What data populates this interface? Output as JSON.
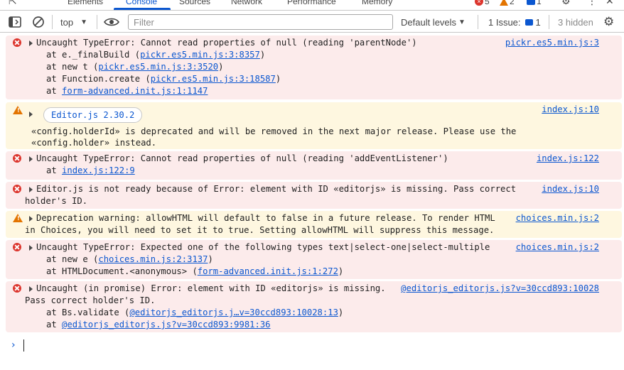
{
  "tabs": {
    "elements": "Elements",
    "console": "Console",
    "sources": "Sources",
    "network": "Network",
    "performance": "Performance",
    "memory": "Memory"
  },
  "counters": {
    "errors": "5",
    "warnings": "2",
    "messages": "1"
  },
  "toolbar": {
    "context": "top",
    "filter_placeholder": "Filter",
    "levels": "Default levels",
    "issues": "1 Issue:",
    "issues_count": "1",
    "hidden": "3 hidden"
  },
  "messages": [
    {
      "type": "error",
      "text": "Uncaught TypeError: Cannot read properties of null (reading 'parentNode')",
      "source": "pickr.es5.min.js:3",
      "stack": [
        {
          "prefix": "at e._finalBuild (",
          "link": "pickr.es5.min.js:3:8357",
          "suffix": ")"
        },
        {
          "prefix": "at new t (",
          "link": "pickr.es5.min.js:3:3520",
          "suffix": ")"
        },
        {
          "prefix": "at Function.create (",
          "link": "pickr.es5.min.js:3:18587",
          "suffix": ")"
        },
        {
          "prefix": "at ",
          "link": "form-advanced.init.js:1:1147",
          "suffix": ""
        }
      ]
    },
    {
      "type": "warn",
      "pill": "Editor.js 2.30.2",
      "source": "index.js:10",
      "line1": "«config.holderId» is deprecated and will be removed in the next major release. Please use the",
      "line2": "«config.holder» instead."
    },
    {
      "type": "error",
      "text": "Uncaught TypeError: Cannot read properties of null (reading 'addEventListener')",
      "source": "index.js:122",
      "stack": [
        {
          "prefix": "at ",
          "link": "index.js:122:9",
          "suffix": ""
        }
      ]
    },
    {
      "type": "error",
      "text": "Editor.js is not ready because of Error: element with ID «editorjs» is missing. Pass correct",
      "text2": "holder's ID.",
      "source": "index.js:10"
    },
    {
      "type": "warn",
      "text": "Deprecation warning: allowHTML will default to false in a future release. To render HTML",
      "text2": "in Choices, you will need to set it to true. Setting allowHTML will suppress this message.",
      "source": "choices.min.js:2"
    },
    {
      "type": "error",
      "text": "Uncaught TypeError: Expected one of the following types text|select-one|select-multiple",
      "source": "choices.min.js:2",
      "stack": [
        {
          "prefix": "at new e (",
          "link": "choices.min.js:2:3137",
          "suffix": ")"
        },
        {
          "prefix": "at HTMLDocument.<anonymous> (",
          "link": "form-advanced.init.js:1:272",
          "suffix": ")"
        }
      ]
    },
    {
      "type": "error",
      "text": "Uncaught (in promise) Error: element with ID «editorjs» is missing.",
      "text2": "Pass correct holder's ID.",
      "source": "@editorjs_editorjs.js?v=30ccd893:10028",
      "stack": [
        {
          "prefix": "at Bs.validate (",
          "link": "@editorjs_editorjs.j…v=30ccd893:10028:13",
          "suffix": ")"
        },
        {
          "prefix": "at ",
          "link": "@editorjs_editorjs.js?v=30ccd893:9981:36",
          "suffix": ""
        }
      ]
    }
  ],
  "colors": {
    "accent": "#0b57d0",
    "error_bg": "#fcebeb",
    "warn_bg": "#fef7e0",
    "error": "#dc362e",
    "warn": "#e37400"
  }
}
